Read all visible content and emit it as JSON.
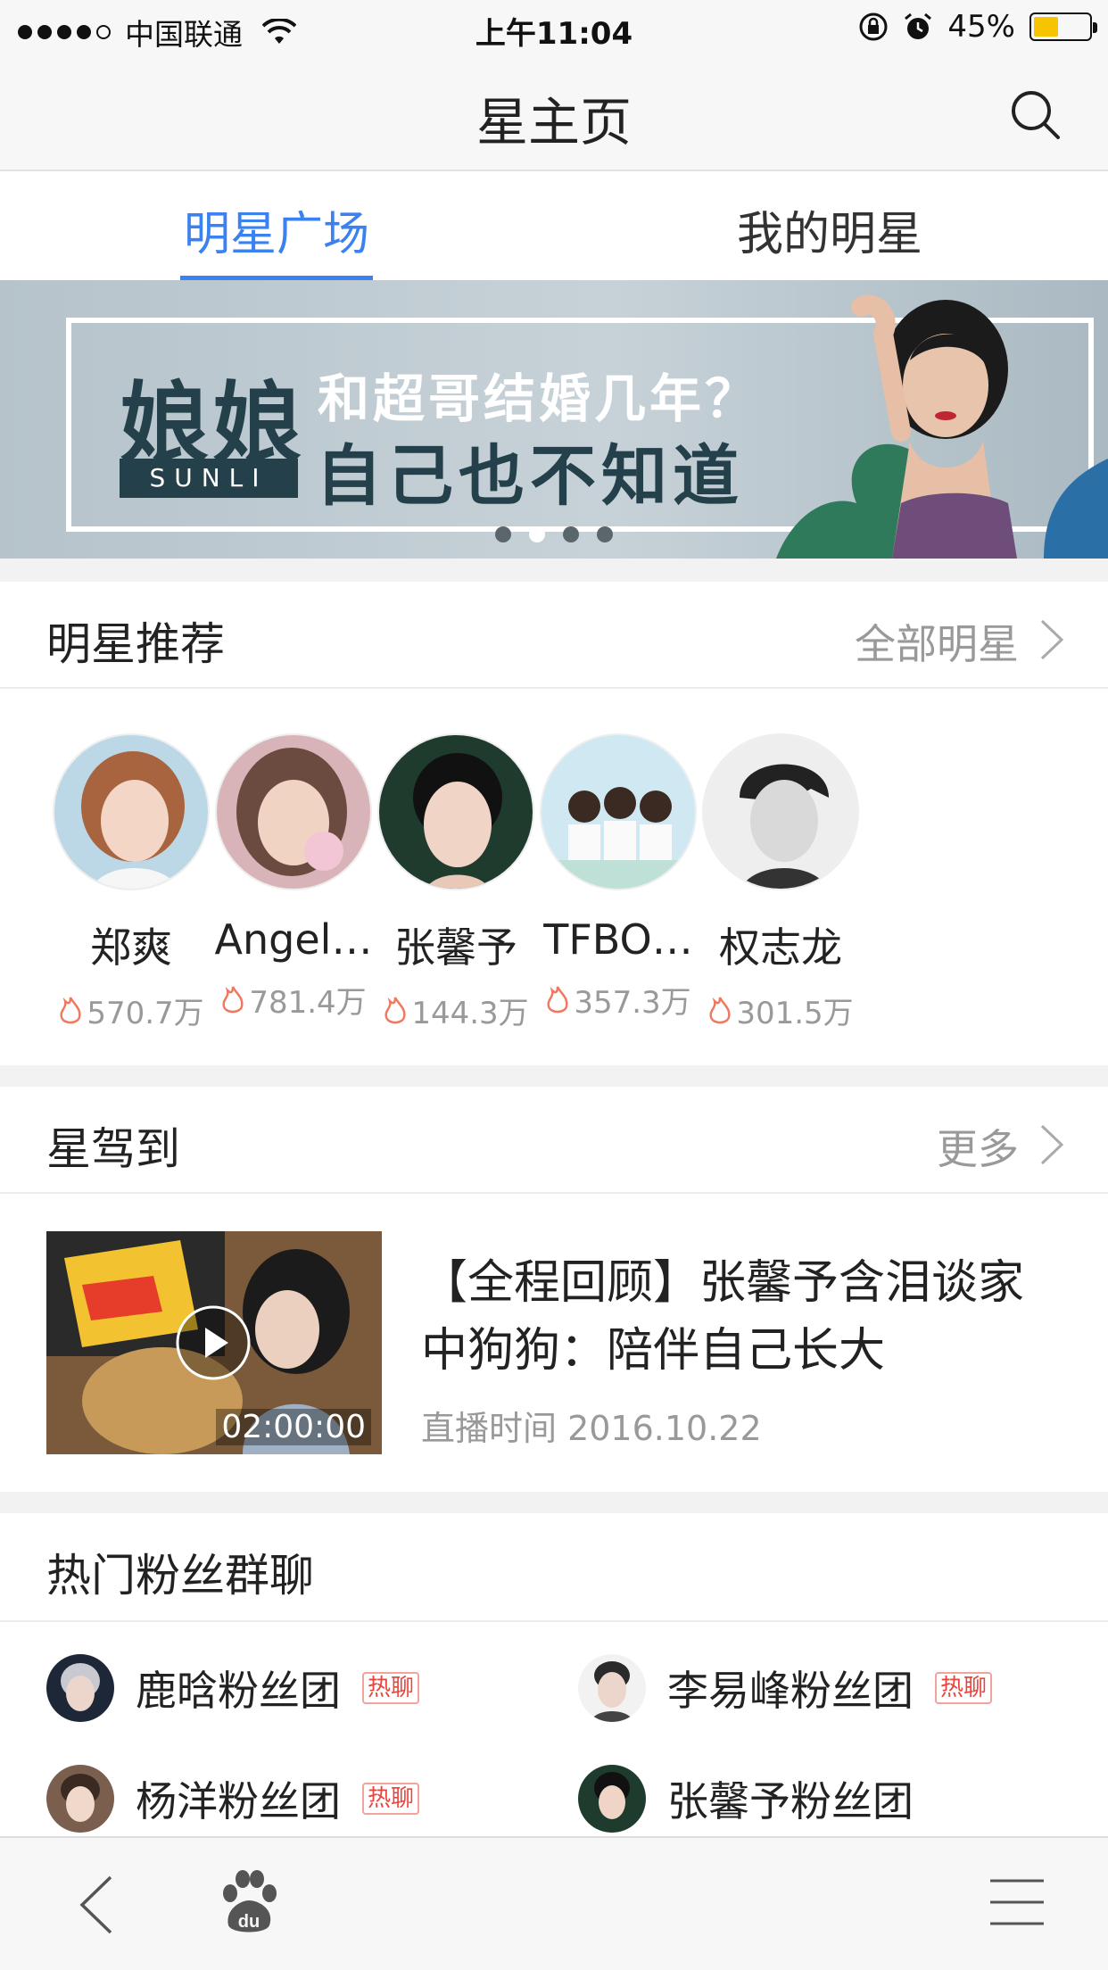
{
  "status_bar": {
    "carrier": "中国联通",
    "time": "上午11:04",
    "battery_percent": "45%",
    "battery_level": 0.45,
    "signal_bars_filled": 4,
    "signal_bars_total": 5
  },
  "nav": {
    "title": "星主页",
    "search_icon": "search-icon"
  },
  "tabs": [
    {
      "label": "明星广场",
      "active": true
    },
    {
      "label": "我的明星",
      "active": false
    }
  ],
  "banner": {
    "big_text": "娘娘",
    "tag": "SUNLI",
    "line1": "和超哥结婚几年？",
    "line2": "自己也不知道",
    "page_count": 4,
    "active_page": 2
  },
  "stars_section": {
    "title": "明星推荐",
    "more": "全部明星",
    "items": [
      {
        "name": "郑爽",
        "heat": "570.7万"
      },
      {
        "name": "Angel…",
        "heat": "781.4万"
      },
      {
        "name": "张馨予",
        "heat": "144.3万"
      },
      {
        "name": "TFBO…",
        "heat": "357.3万"
      },
      {
        "name": "权志龙",
        "heat": "301.5万"
      }
    ]
  },
  "live_section": {
    "title": "星驾到",
    "more": "更多",
    "video": {
      "title": "【全程回顾】张馨予含泪谈家中狗狗：陪伴自己长大",
      "time": "直播时间 2016.10.22",
      "duration": "02:00:00"
    }
  },
  "fans_section": {
    "title": "热门粉丝群聊",
    "hot_label": "热聊",
    "groups": [
      {
        "name": "鹿晗粉丝团",
        "hot": true
      },
      {
        "name": "李易峰粉丝团",
        "hot": true
      },
      {
        "name": "杨洋粉丝团",
        "hot": true
      },
      {
        "name": "张馨予粉丝团",
        "hot": false
      }
    ]
  },
  "toolbar": {
    "icons": [
      "back-icon",
      "baidu-paw-icon",
      "menu-icon"
    ]
  },
  "colors": {
    "accent": "#3b82f0",
    "hot": "#e8463c",
    "battery": "#f6c400"
  }
}
